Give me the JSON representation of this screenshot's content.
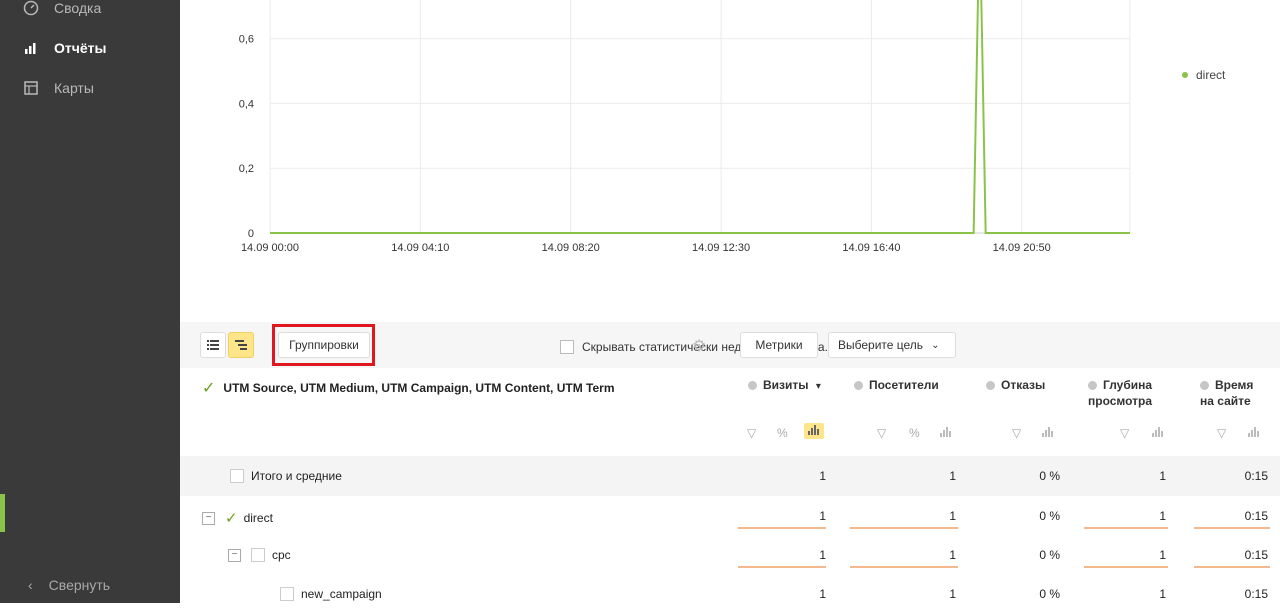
{
  "sidebar": {
    "items": [
      {
        "label": "Сводка",
        "icon": "gauge-icon",
        "active": false
      },
      {
        "label": "Отчёты",
        "icon": "bar-chart-icon",
        "active": true
      },
      {
        "label": "Карты",
        "icon": "map-icon",
        "active": false
      }
    ],
    "collapse_label": "Свернуть"
  },
  "chart_data": {
    "type": "line",
    "x": [
      "14.09 00:00",
      "14.09 04:10",
      "14.09 08:20",
      "14.09 12:30",
      "14.09 16:40",
      "14.09 20:50"
    ],
    "y_ticks": [
      "0",
      "0,2",
      "0,4",
      "0,6"
    ],
    "ylim": [
      0,
      0.75
    ],
    "series": [
      {
        "name": "direct",
        "color": "#8bc34a",
        "points": [
          [
            "14.09 00:00",
            0
          ],
          [
            "14.09 19:30",
            0
          ],
          [
            "14.09 19:40",
            1
          ],
          [
            "14.09 19:50",
            0
          ],
          [
            "14.09 23:50",
            0
          ]
        ]
      }
    ],
    "grid": true,
    "legend": "right"
  },
  "toolbar": {
    "group_label": "Группировки",
    "hide_stat_label": "Скрывать статистически недостоверные да...",
    "metrics_label": "Метрики",
    "goal_label": "Выберите цель"
  },
  "table": {
    "dimension_header": "UTM Source, UTM Medium, UTM Campaign, UTM Content, UTM Term",
    "columns": [
      {
        "label": "Визиты",
        "sort": "▾"
      },
      {
        "label": "Посетители"
      },
      {
        "label": "Отказы"
      },
      {
        "label": "Глубина просмотра"
      },
      {
        "label": "Время на сайте"
      }
    ],
    "rows": [
      {
        "label": "Итого и средние",
        "values": [
          "1",
          "1",
          "0 %",
          "1",
          "0:15"
        ]
      },
      {
        "label": "direct",
        "values": [
          "1",
          "1",
          "0 %",
          "1",
          "0:15"
        ]
      },
      {
        "label": "cpc",
        "values": [
          "1",
          "1",
          "0 %",
          "1",
          "0:15"
        ]
      },
      {
        "label": "new_campaign",
        "values": [
          "1",
          "1",
          "0 %",
          "1",
          "0:15"
        ]
      }
    ]
  },
  "colors": {
    "accent": "#8bc34a",
    "highlight": "#ffe58a",
    "outline": "#e0171f",
    "bar": "#f3b98c"
  }
}
